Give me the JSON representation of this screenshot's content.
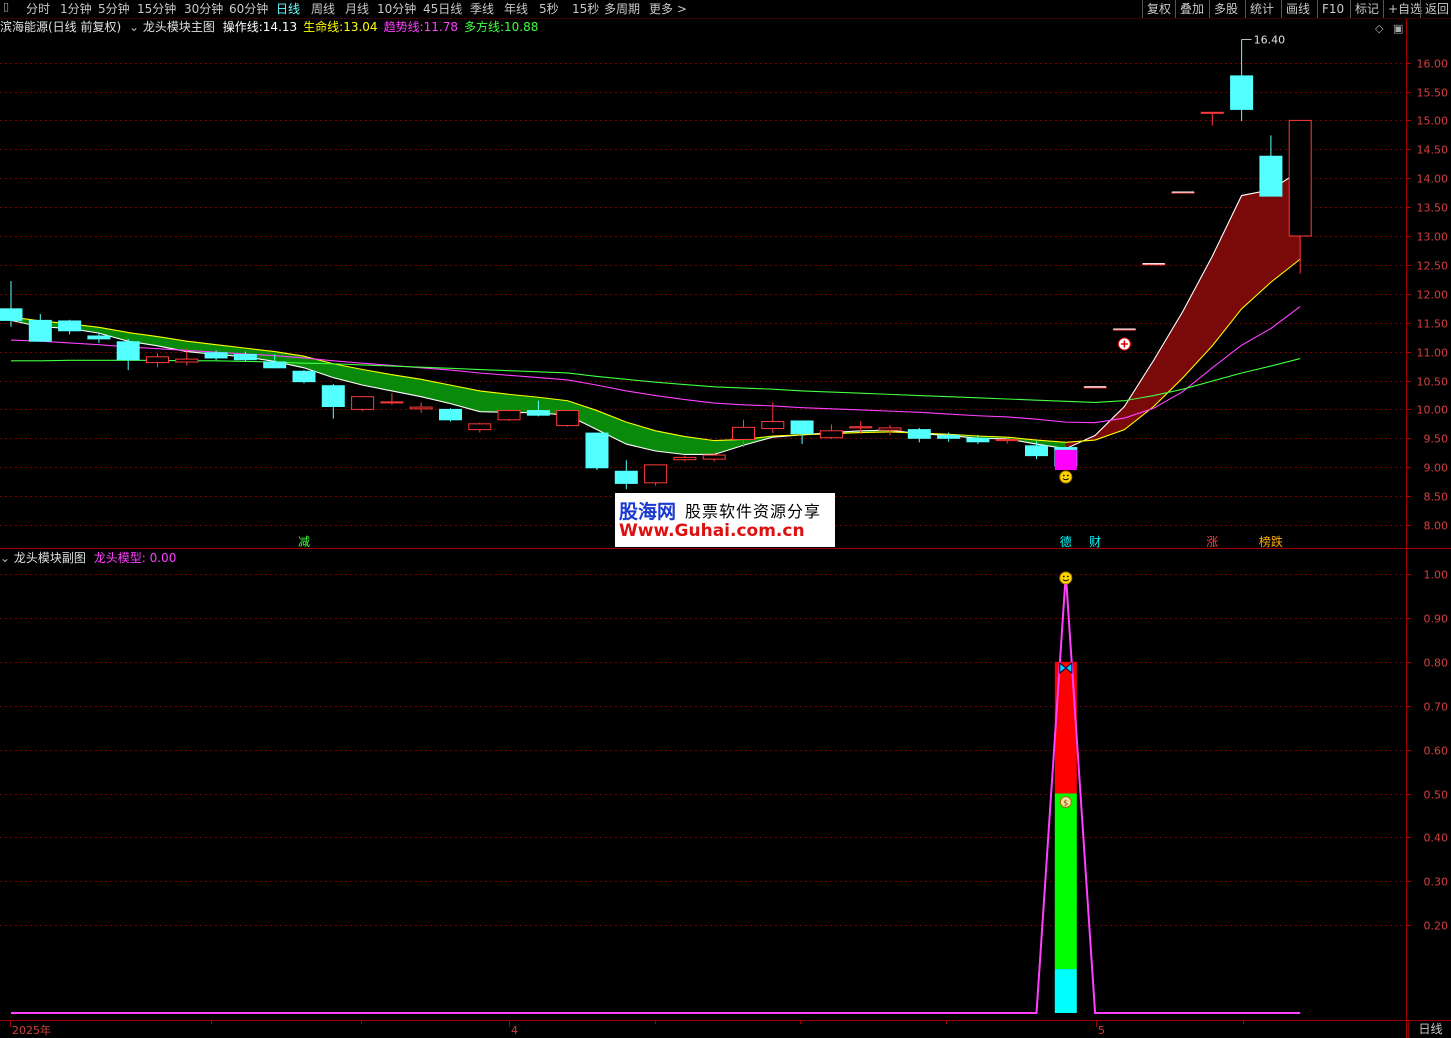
{
  "toolbar": {
    "tabs": [
      "分时",
      "1分钟",
      "5分钟",
      "15分钟",
      "30分钟",
      "60分钟",
      "日线",
      "周线",
      "月线",
      "10分钟",
      "45日线",
      "季线",
      "年线",
      "5秒",
      "15秒",
      "多周期",
      "更多 >"
    ],
    "active_tab": "日线",
    "right_buttons": [
      "复权",
      "叠加",
      "多股",
      "统计",
      "画线",
      "F10",
      "标记",
      "+自选",
      "返回"
    ]
  },
  "main_header": {
    "stock": "滨海能源(日线 前复权)",
    "indicator": "龙头模块主图",
    "items": [
      {
        "label": "操作线:",
        "value": "14.13",
        "color": "#ffffff"
      },
      {
        "label": "生命线:",
        "value": "13.04",
        "color": "#ffff00"
      },
      {
        "label": "趋势线:",
        "value": "11.78",
        "color": "#ff40ff"
      },
      {
        "label": "多方线:",
        "value": "10.88",
        "color": "#40ff40"
      }
    ]
  },
  "sub_header": {
    "indicator": "龙头模块副图",
    "label": "龙头模型:",
    "value": "0.00"
  },
  "watermark": {
    "brand": "股海网",
    "slogan": "股票软件资源分享",
    "url": "Www.Guhai.com.cn"
  },
  "bottom_tab": "日线",
  "chart_data": [
    {
      "type": "candlestick",
      "name": "main",
      "ylim": [
        7.7,
        16.5
      ],
      "y_ticks": [
        "16.00",
        "15.50",
        "15.00",
        "14.50",
        "14.00",
        "13.50",
        "13.00",
        "12.50",
        "12.00",
        "11.50",
        "11.00",
        "10.50",
        "10.00",
        "9.50",
        "9.00",
        "8.50",
        "8.00"
      ],
      "x_labels": [
        "2025年",
        "4",
        "5"
      ],
      "max_label": "16.40",
      "candles": [
        {
          "o": 11.74,
          "h": 12.22,
          "l": 11.43,
          "c": 11.54
        },
        {
          "o": 11.54,
          "h": 11.65,
          "l": 11.17,
          "c": 11.18
        },
        {
          "o": 11.53,
          "h": 11.55,
          "l": 11.3,
          "c": 11.36
        },
        {
          "o": 11.27,
          "h": 11.33,
          "l": 11.15,
          "c": 11.22
        },
        {
          "o": 11.17,
          "h": 11.22,
          "l": 10.68,
          "c": 10.86
        },
        {
          "o": 10.81,
          "h": 10.97,
          "l": 10.73,
          "c": 10.91
        },
        {
          "o": 10.82,
          "h": 11.06,
          "l": 10.76,
          "c": 10.87
        },
        {
          "o": 10.98,
          "h": 11.02,
          "l": 10.85,
          "c": 10.89
        },
        {
          "o": 10.95,
          "h": 11.0,
          "l": 10.82,
          "c": 10.86
        },
        {
          "o": 10.82,
          "h": 10.95,
          "l": 10.71,
          "c": 10.72
        },
        {
          "o": 10.66,
          "h": 10.68,
          "l": 10.45,
          "c": 10.48
        },
        {
          "o": 10.41,
          "h": 10.44,
          "l": 9.84,
          "c": 10.05
        },
        {
          "o": 10.0,
          "h": 10.23,
          "l": 9.97,
          "c": 10.22
        },
        {
          "o": 10.13,
          "h": 10.28,
          "l": 10.08,
          "c": 10.13
        },
        {
          "o": 10.01,
          "h": 10.12,
          "l": 9.94,
          "c": 10.04
        },
        {
          "o": 10.0,
          "h": 10.02,
          "l": 9.79,
          "c": 9.82
        },
        {
          "o": 9.65,
          "h": 9.77,
          "l": 9.6,
          "c": 9.75
        },
        {
          "o": 9.82,
          "h": 10.0,
          "l": 9.8,
          "c": 9.98
        },
        {
          "o": 9.98,
          "h": 10.15,
          "l": 9.88,
          "c": 9.9
        },
        {
          "o": 9.72,
          "h": 9.99,
          "l": 9.7,
          "c": 9.98
        },
        {
          "o": 9.59,
          "h": 9.6,
          "l": 8.95,
          "c": 8.99
        },
        {
          "o": 8.93,
          "h": 9.12,
          "l": 8.62,
          "c": 8.72
        },
        {
          "o": 8.73,
          "h": 9.05,
          "l": 8.68,
          "c": 9.04
        },
        {
          "o": 9.13,
          "h": 9.2,
          "l": 9.1,
          "c": 9.17
        },
        {
          "o": 9.14,
          "h": 9.25,
          "l": 9.1,
          "c": 9.21
        },
        {
          "o": 9.48,
          "h": 9.82,
          "l": 9.35,
          "c": 9.69
        },
        {
          "o": 9.67,
          "h": 10.12,
          "l": 9.59,
          "c": 9.79
        },
        {
          "o": 9.8,
          "h": 9.81,
          "l": 9.4,
          "c": 9.58
        },
        {
          "o": 9.51,
          "h": 9.74,
          "l": 9.49,
          "c": 9.63
        },
        {
          "o": 9.68,
          "h": 9.8,
          "l": 9.58,
          "c": 9.7
        },
        {
          "o": 9.64,
          "h": 9.73,
          "l": 9.55,
          "c": 9.68
        },
        {
          "o": 9.65,
          "h": 9.68,
          "l": 9.43,
          "c": 9.5
        },
        {
          "o": 9.55,
          "h": 9.6,
          "l": 9.44,
          "c": 9.5
        },
        {
          "o": 9.5,
          "h": 9.56,
          "l": 9.4,
          "c": 9.44
        },
        {
          "o": 9.46,
          "h": 9.5,
          "l": 9.41,
          "c": 9.48
        },
        {
          "o": 9.37,
          "h": 9.45,
          "l": 9.14,
          "c": 9.2
        },
        {
          "o": 9.34,
          "h": 9.35,
          "l": 9.02,
          "c": 9.02
        },
        {
          "o": 10.39,
          "h": 10.4,
          "l": 10.38,
          "c": 10.39
        },
        {
          "o": 11.39,
          "h": 11.4,
          "l": 11.38,
          "c": 11.39
        },
        {
          "o": 12.52,
          "h": 12.53,
          "l": 12.51,
          "c": 12.52
        },
        {
          "o": 13.76,
          "h": 13.77,
          "l": 13.75,
          "c": 13.76
        },
        {
          "o": 15.14,
          "h": 15.15,
          "l": 14.91,
          "c": 15.14
        },
        {
          "o": 15.77,
          "h": 16.4,
          "l": 14.99,
          "c": 15.19
        },
        {
          "o": 14.38,
          "h": 14.74,
          "l": 13.7,
          "c": 13.69
        },
        {
          "o": 13.0,
          "h": 15.0,
          "l": 12.35,
          "c": 15.0
        }
      ],
      "series": [
        {
          "name": "操作线",
          "color": "#ffffff",
          "values": [
            11.54,
            11.43,
            11.4,
            11.32,
            11.18,
            11.1,
            11.0,
            10.95,
            10.91,
            10.83,
            10.72,
            10.55,
            10.42,
            10.32,
            10.22,
            10.1,
            9.96,
            9.95,
            9.94,
            9.9,
            9.65,
            9.4,
            9.28,
            9.22,
            9.22,
            9.38,
            9.52,
            9.56,
            9.6,
            9.63,
            9.64,
            9.58,
            9.55,
            9.5,
            9.49,
            9.4,
            9.32,
            9.55,
            10.05,
            10.85,
            11.7,
            12.65,
            13.7,
            13.8,
            14.13
          ]
        },
        {
          "name": "生命线",
          "color": "#ffff00",
          "values": [
            11.6,
            11.53,
            11.48,
            11.42,
            11.33,
            11.26,
            11.18,
            11.12,
            11.06,
            11.0,
            10.92,
            10.79,
            10.69,
            10.6,
            10.52,
            10.42,
            10.32,
            10.26,
            10.21,
            10.15,
            9.98,
            9.78,
            9.63,
            9.53,
            9.46,
            9.48,
            9.54,
            9.56,
            9.58,
            9.6,
            9.61,
            9.59,
            9.57,
            9.54,
            9.52,
            9.47,
            9.43,
            9.47,
            9.65,
            10.05,
            10.55,
            11.1,
            11.74,
            12.2,
            12.6
          ]
        },
        {
          "name": "趋势线",
          "color": "#ff40ff",
          "values": [
            11.2,
            11.18,
            11.15,
            11.12,
            11.08,
            11.05,
            11.02,
            10.99,
            10.96,
            10.93,
            10.89,
            10.84,
            10.8,
            10.76,
            10.72,
            10.68,
            10.63,
            10.59,
            10.55,
            10.51,
            10.42,
            10.32,
            10.24,
            10.17,
            10.11,
            10.08,
            10.06,
            10.03,
            10.01,
            9.99,
            9.97,
            9.95,
            9.92,
            9.89,
            9.87,
            9.83,
            9.78,
            9.77,
            9.85,
            10.02,
            10.31,
            10.72,
            11.11,
            11.4,
            11.78
          ]
        },
        {
          "name": "多方线",
          "color": "#40ff40",
          "values": [
            10.84,
            10.84,
            10.85,
            10.85,
            10.85,
            10.85,
            10.84,
            10.84,
            10.83,
            10.82,
            10.8,
            10.79,
            10.77,
            10.75,
            10.73,
            10.71,
            10.69,
            10.67,
            10.65,
            10.63,
            10.57,
            10.52,
            10.47,
            10.43,
            10.39,
            10.37,
            10.35,
            10.32,
            10.3,
            10.28,
            10.26,
            10.24,
            10.22,
            10.2,
            10.18,
            10.16,
            10.14,
            10.12,
            10.15,
            10.24,
            10.35,
            10.49,
            10.63,
            10.75,
            10.88
          ]
        }
      ],
      "markers": [
        {
          "text": "减",
          "index": 10,
          "color": "#40ff40"
        },
        {
          "text": "德",
          "index": 36,
          "color": "#00ffff"
        },
        {
          "text": "财",
          "index": 37,
          "color": "#00ffff"
        },
        {
          "text": "涨",
          "index": 41,
          "color": "#ff4040"
        },
        {
          "text": "榜跌",
          "index": 43,
          "color": "#ffaa00"
        }
      ],
      "signal_block": {
        "index": 36,
        "color": "#ff00ff"
      }
    },
    {
      "type": "line",
      "name": "sub",
      "ylim": [
        0,
        1.05
      ],
      "y_ticks": [
        "1.00",
        "0.90",
        "0.80",
        "0.70",
        "0.60",
        "0.50",
        "0.40",
        "0.30",
        "0.20"
      ],
      "series": [
        {
          "name": "龙头模型",
          "color": "#ff40ff",
          "values": [
            0,
            0,
            0,
            0,
            0,
            0,
            0,
            0,
            0,
            0,
            0,
            0,
            0,
            0,
            0,
            0,
            0,
            0,
            0,
            0,
            0,
            0,
            0,
            0,
            0,
            0,
            0,
            0,
            0,
            0,
            0,
            0,
            0,
            0,
            0,
            0,
            1.0,
            0,
            0,
            0,
            0,
            0,
            0,
            0,
            0
          ]
        }
      ],
      "bars": [
        {
          "index": 36,
          "from": 0.1,
          "to": 0.5,
          "color": "#00ff00"
        },
        {
          "index": 36,
          "from": 0.5,
          "to": 0.8,
          "color": "#ff0000"
        },
        {
          "index": 36,
          "from": 0,
          "to": 0.1,
          "color": "#00ffff"
        }
      ]
    }
  ]
}
